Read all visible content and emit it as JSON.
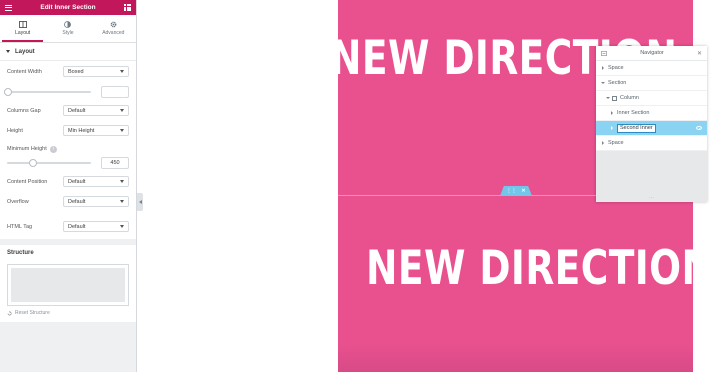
{
  "panel": {
    "title": "Edit Inner Section",
    "tabs": [
      {
        "label": "Layout",
        "icon": "layout-icon"
      },
      {
        "label": "Style",
        "icon": "style-icon"
      },
      {
        "label": "Advanced",
        "icon": "gear-icon"
      }
    ],
    "layout_section": "Layout",
    "content_width": {
      "label": "Content Width",
      "value": "Boxed"
    },
    "boxed_width_value": "",
    "columns_gap": {
      "label": "Columns Gap",
      "value": "Default"
    },
    "height": {
      "label": "Height",
      "value": "Min Height"
    },
    "min_height": {
      "label": "Minimum Height",
      "value": "450"
    },
    "content_position": {
      "label": "Content Position",
      "value": "Default"
    },
    "overflow": {
      "label": "Overflow",
      "value": "Default"
    },
    "html_tag": {
      "label": "HTML Tag",
      "value": "Default"
    },
    "structure": {
      "label": "Structure",
      "reset_label": "Reset Structure"
    }
  },
  "canvas": {
    "headline_top": "NEW DIRECTION",
    "headline_bottom": "NEW DIRECTION",
    "background_color": "#e8508e",
    "section_handle_color": "#71c6ea"
  },
  "navigator": {
    "title": "Navigator",
    "items": [
      {
        "label": "Space"
      },
      {
        "label": "Section"
      },
      {
        "label": "Column"
      },
      {
        "label": "Inner Section"
      },
      {
        "label": "Second Inner"
      },
      {
        "label": "Space"
      }
    ]
  },
  "colors": {
    "accent": "#c2185b",
    "selection": "#8ad3f2"
  }
}
